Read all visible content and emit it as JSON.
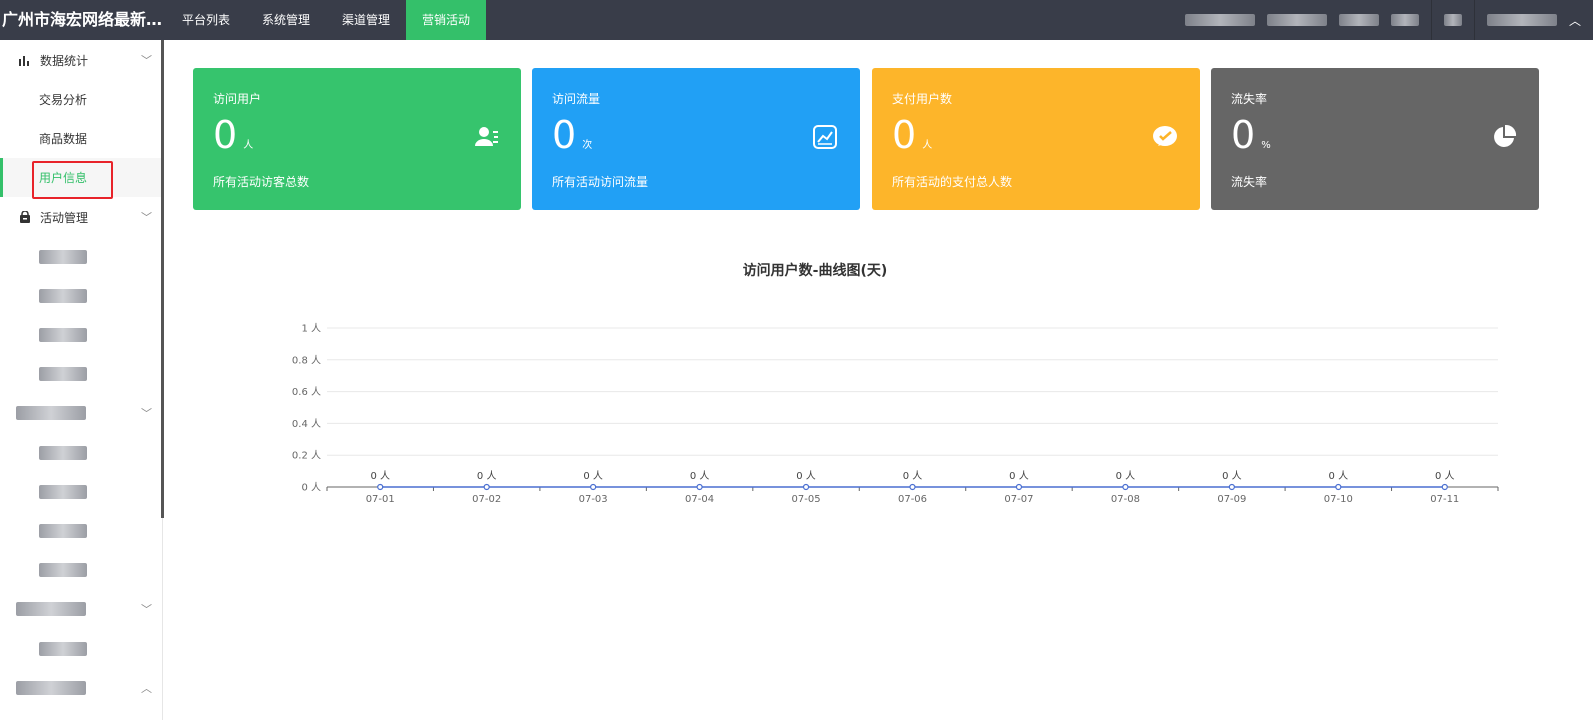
{
  "brand": "广州市海宏网络最新红...",
  "topnav": [
    {
      "label": "平台列表",
      "active": false
    },
    {
      "label": "系统管理",
      "active": false
    },
    {
      "label": "渠道管理",
      "active": false
    },
    {
      "label": "营销活动",
      "active": true
    }
  ],
  "sidebar": {
    "group1": {
      "label": "数据统计"
    },
    "items1": [
      {
        "label": "交易分析"
      },
      {
        "label": "商品数据"
      },
      {
        "label": "用户信息",
        "active": true
      }
    ],
    "group2": {
      "label": "活动管理"
    }
  },
  "cards": [
    {
      "title": "访问用户",
      "value": "0",
      "unit": "人",
      "desc": "所有活动访客总数",
      "icon": "user-icon",
      "color": "#36c46d"
    },
    {
      "title": "访问流量",
      "value": "0",
      "unit": "次",
      "desc": "所有活动访问流量",
      "icon": "trend-chart-icon",
      "color": "#21a0f5"
    },
    {
      "title": "支付用户数",
      "value": "0",
      "unit": "人",
      "desc": "所有活动的支付总人数",
      "icon": "wechat-pay-icon",
      "color": "#fdb52a"
    },
    {
      "title": "流失率",
      "value": "0",
      "unit": "%",
      "desc": "流失率",
      "icon": "pie-chart-icon",
      "color": "#666666"
    }
  ],
  "chart_data": {
    "type": "line",
    "title": "访问用户数-曲线图(天)",
    "categories": [
      "07-01",
      "07-02",
      "07-03",
      "07-04",
      "07-05",
      "07-06",
      "07-07",
      "07-08",
      "07-09",
      "07-10",
      "07-11"
    ],
    "values": [
      0,
      0,
      0,
      0,
      0,
      0,
      0,
      0,
      0,
      0,
      0
    ],
    "point_label_suffix": " 人",
    "ylim": [
      0,
      1
    ],
    "yticks": [
      "0 人",
      "0.2 人",
      "0.4 人",
      "0.6 人",
      "0.8 人",
      "1 人"
    ],
    "grid": true,
    "line_color": "#4a6fd1"
  }
}
